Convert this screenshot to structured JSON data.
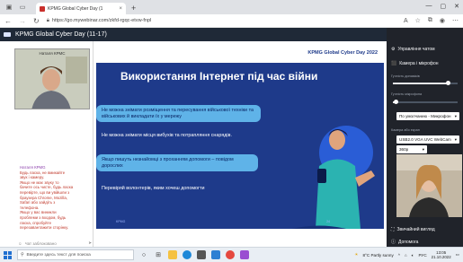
{
  "browser": {
    "tab_title": "KPMG Global Cyber Day (1",
    "url": "https://go.mywebinar.com/zkfd-rgqc-etvw-fnpl",
    "tab_close": "×",
    "new_tab": "+"
  },
  "webinar": {
    "title": "KPMG Global Cyber Day (11-17)"
  },
  "left_panel": {
    "camera_label": "Наталя КРМС",
    "chat_messages": [
      "Наталя КРМG",
      "Будь ласка, не вмикайте",
      "звук і камеру.",
      "Якщо не має звуку то",
      "бачите ось чисте, будь ласка",
      "перевірте, що ви увійшли з",
      "браузера Chrome, Mozilla,",
      "Safari або зайдіть з",
      "телефона.",
      "Якщо у вас виникли",
      "проблеми з входом, будь",
      "ласка, спробуйте",
      "перезавантажити сторінку."
    ],
    "chat_placeholder": "Чат заблоковано"
  },
  "slide": {
    "logo": "KPMG Global Cyber Day 2022",
    "title": "Використання Інтернет під час війни",
    "bullets": [
      "Не можна знімати розміщення та пересування військової техніки та військових й викладати їх у мережу",
      "Не можна знімати місця вибухів та потрапляння снарядів.",
      "Якщо пишуть незнайомці з проханням допомоги – повідом дорослих",
      "Перевіряй волонтерів, яким хочеш допомогти"
    ]
  },
  "right_panel": {
    "chat_control": "Управління чатом",
    "cam_mic": "Камера і мікрофон",
    "volume_label": "Гучність динаміків",
    "mic_volume_label": "Гучність мікрофона",
    "mic_select": "По умолчанию - Микрофон",
    "camera_label": "Камера або екран",
    "camera_select": "USB2.0 VGA UVC WebCam",
    "resolution_select": "360p",
    "speaker_view": "Звичайний вигляд",
    "help": "Допомога",
    "speaker_volume": 0.85,
    "mic_volume": 0.05
  },
  "taskbar": {
    "search_placeholder": "Введите здесь текст для поиска",
    "weather": "8°C Partly sunny",
    "lang": "РУС",
    "time": "13:05",
    "date": "21.10.2022"
  },
  "colors": {
    "slide_bg": "#1e3a8a",
    "pill": "#5fb3e8",
    "header_bg": "#1f2937",
    "right_panel_bg": "#20232a"
  }
}
